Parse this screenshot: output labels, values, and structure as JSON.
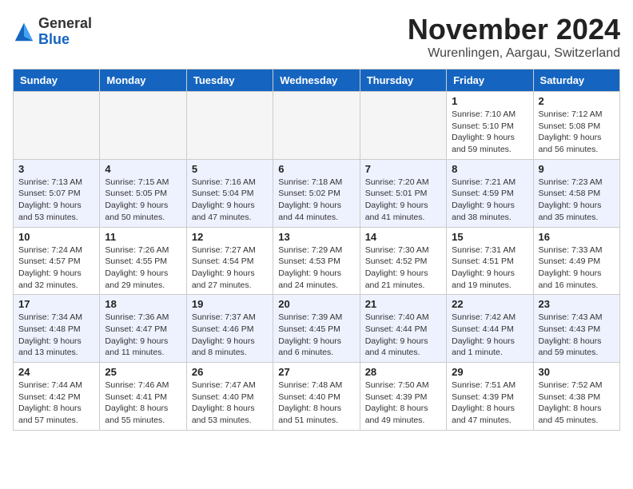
{
  "header": {
    "logo_general": "General",
    "logo_blue": "Blue",
    "month_title": "November 2024",
    "location": "Wurenlingen, Aargau, Switzerland"
  },
  "days_of_week": [
    "Sunday",
    "Monday",
    "Tuesday",
    "Wednesday",
    "Thursday",
    "Friday",
    "Saturday"
  ],
  "weeks": [
    [
      {
        "day": "",
        "info": ""
      },
      {
        "day": "",
        "info": ""
      },
      {
        "day": "",
        "info": ""
      },
      {
        "day": "",
        "info": ""
      },
      {
        "day": "",
        "info": ""
      },
      {
        "day": "1",
        "info": "Sunrise: 7:10 AM\nSunset: 5:10 PM\nDaylight: 9 hours and 59 minutes."
      },
      {
        "day": "2",
        "info": "Sunrise: 7:12 AM\nSunset: 5:08 PM\nDaylight: 9 hours and 56 minutes."
      }
    ],
    [
      {
        "day": "3",
        "info": "Sunrise: 7:13 AM\nSunset: 5:07 PM\nDaylight: 9 hours and 53 minutes."
      },
      {
        "day": "4",
        "info": "Sunrise: 7:15 AM\nSunset: 5:05 PM\nDaylight: 9 hours and 50 minutes."
      },
      {
        "day": "5",
        "info": "Sunrise: 7:16 AM\nSunset: 5:04 PM\nDaylight: 9 hours and 47 minutes."
      },
      {
        "day": "6",
        "info": "Sunrise: 7:18 AM\nSunset: 5:02 PM\nDaylight: 9 hours and 44 minutes."
      },
      {
        "day": "7",
        "info": "Sunrise: 7:20 AM\nSunset: 5:01 PM\nDaylight: 9 hours and 41 minutes."
      },
      {
        "day": "8",
        "info": "Sunrise: 7:21 AM\nSunset: 4:59 PM\nDaylight: 9 hours and 38 minutes."
      },
      {
        "day": "9",
        "info": "Sunrise: 7:23 AM\nSunset: 4:58 PM\nDaylight: 9 hours and 35 minutes."
      }
    ],
    [
      {
        "day": "10",
        "info": "Sunrise: 7:24 AM\nSunset: 4:57 PM\nDaylight: 9 hours and 32 minutes."
      },
      {
        "day": "11",
        "info": "Sunrise: 7:26 AM\nSunset: 4:55 PM\nDaylight: 9 hours and 29 minutes."
      },
      {
        "day": "12",
        "info": "Sunrise: 7:27 AM\nSunset: 4:54 PM\nDaylight: 9 hours and 27 minutes."
      },
      {
        "day": "13",
        "info": "Sunrise: 7:29 AM\nSunset: 4:53 PM\nDaylight: 9 hours and 24 minutes."
      },
      {
        "day": "14",
        "info": "Sunrise: 7:30 AM\nSunset: 4:52 PM\nDaylight: 9 hours and 21 minutes."
      },
      {
        "day": "15",
        "info": "Sunrise: 7:31 AM\nSunset: 4:51 PM\nDaylight: 9 hours and 19 minutes."
      },
      {
        "day": "16",
        "info": "Sunrise: 7:33 AM\nSunset: 4:49 PM\nDaylight: 9 hours and 16 minutes."
      }
    ],
    [
      {
        "day": "17",
        "info": "Sunrise: 7:34 AM\nSunset: 4:48 PM\nDaylight: 9 hours and 13 minutes."
      },
      {
        "day": "18",
        "info": "Sunrise: 7:36 AM\nSunset: 4:47 PM\nDaylight: 9 hours and 11 minutes."
      },
      {
        "day": "19",
        "info": "Sunrise: 7:37 AM\nSunset: 4:46 PM\nDaylight: 9 hours and 8 minutes."
      },
      {
        "day": "20",
        "info": "Sunrise: 7:39 AM\nSunset: 4:45 PM\nDaylight: 9 hours and 6 minutes."
      },
      {
        "day": "21",
        "info": "Sunrise: 7:40 AM\nSunset: 4:44 PM\nDaylight: 9 hours and 4 minutes."
      },
      {
        "day": "22",
        "info": "Sunrise: 7:42 AM\nSunset: 4:44 PM\nDaylight: 9 hours and 1 minute."
      },
      {
        "day": "23",
        "info": "Sunrise: 7:43 AM\nSunset: 4:43 PM\nDaylight: 8 hours and 59 minutes."
      }
    ],
    [
      {
        "day": "24",
        "info": "Sunrise: 7:44 AM\nSunset: 4:42 PM\nDaylight: 8 hours and 57 minutes."
      },
      {
        "day": "25",
        "info": "Sunrise: 7:46 AM\nSunset: 4:41 PM\nDaylight: 8 hours and 55 minutes."
      },
      {
        "day": "26",
        "info": "Sunrise: 7:47 AM\nSunset: 4:40 PM\nDaylight: 8 hours and 53 minutes."
      },
      {
        "day": "27",
        "info": "Sunrise: 7:48 AM\nSunset: 4:40 PM\nDaylight: 8 hours and 51 minutes."
      },
      {
        "day": "28",
        "info": "Sunrise: 7:50 AM\nSunset: 4:39 PM\nDaylight: 8 hours and 49 minutes."
      },
      {
        "day": "29",
        "info": "Sunrise: 7:51 AM\nSunset: 4:39 PM\nDaylight: 8 hours and 47 minutes."
      },
      {
        "day": "30",
        "info": "Sunrise: 7:52 AM\nSunset: 4:38 PM\nDaylight: 8 hours and 45 minutes."
      }
    ]
  ]
}
